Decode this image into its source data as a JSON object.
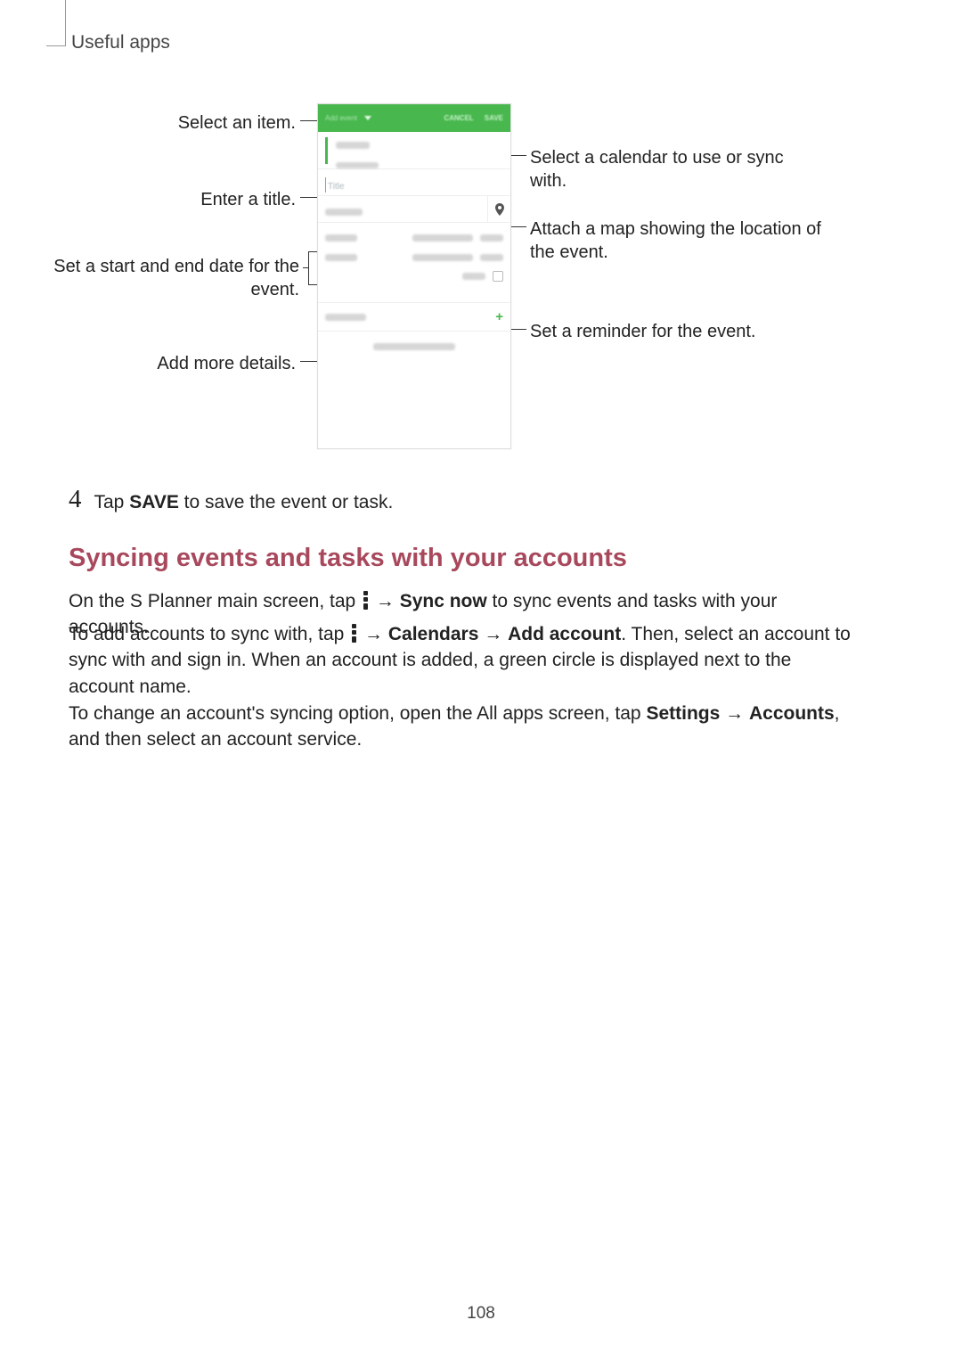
{
  "header": {
    "title": "Useful apps"
  },
  "callouts": {
    "select_item": "Select an item.",
    "enter_title": "Enter a title.",
    "set_dates": "Set a start and end date for the event.",
    "add_more": "Add more details.",
    "select_calendar": "Select a calendar to use or sync with.",
    "attach_map": "Attach a map showing the location of the event.",
    "set_reminder": "Set a reminder for the event."
  },
  "step": {
    "num": "4",
    "text_pre": "Tap ",
    "text_bold": "SAVE",
    "text_post": " to save the event or task."
  },
  "section_heading": "Syncing events and tasks with your accounts",
  "para1": {
    "pre": "On the S Planner main screen, tap ",
    "arrow": " → ",
    "bold1": "Sync now",
    "post": " to sync events and tasks with your accounts."
  },
  "para2": {
    "pre": "To add accounts to sync with, tap ",
    "arrow1": " → ",
    "bold1": "Calendars",
    "arrow2": " → ",
    "bold2": "Add account",
    "post": ". Then, select an account to sync with and sign in. When an account is added, a green circle is displayed next to the account name."
  },
  "para3": {
    "pre": "To change an account's syncing option, open the All apps screen, tap ",
    "bold1": "Settings",
    "arrow": " → ",
    "bold2": "Accounts",
    "post": ", and then select an account service."
  },
  "phone": {
    "topbar_label": "Add event",
    "cancel": "CANCEL",
    "save": "SAVE",
    "title_placeholder": "Title"
  },
  "page_number": "108"
}
